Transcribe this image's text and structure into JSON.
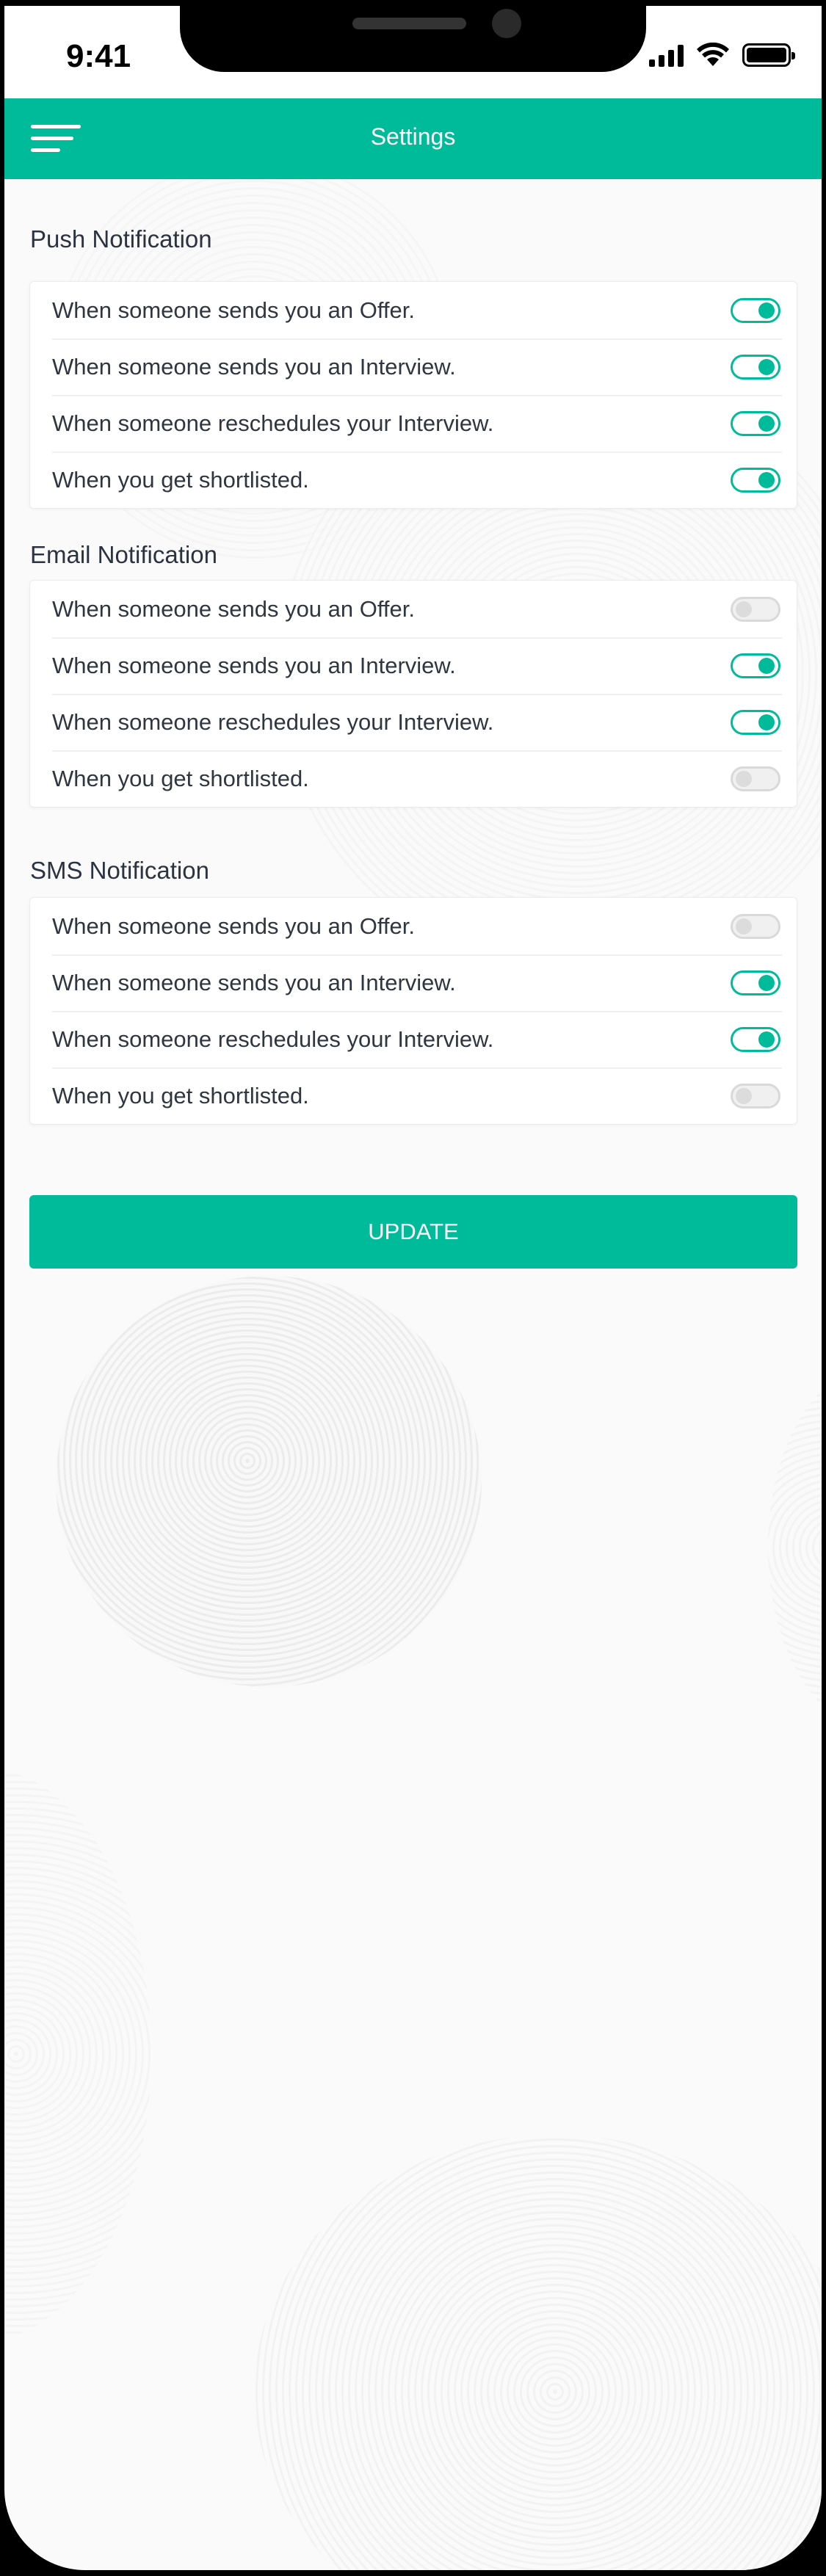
{
  "status_bar": {
    "time": "9:41"
  },
  "header": {
    "title": "Settings"
  },
  "sections": [
    {
      "title": "Push Notification",
      "items": [
        {
          "label": "When someone sends you an Offer.",
          "enabled": true
        },
        {
          "label": "When someone sends you an Interview.",
          "enabled": true
        },
        {
          "label": "When someone reschedules your Interview.",
          "enabled": true
        },
        {
          "label": "When you get shortlisted.",
          "enabled": true
        }
      ]
    },
    {
      "title": "Email Notification",
      "items": [
        {
          "label": "When someone sends you an Offer.",
          "enabled": false
        },
        {
          "label": "When someone sends you an Interview.",
          "enabled": true
        },
        {
          "label": "When someone reschedules your Interview.",
          "enabled": true
        },
        {
          "label": "When you get shortlisted.",
          "enabled": false
        }
      ]
    },
    {
      "title": "SMS Notification",
      "items": [
        {
          "label": "When someone sends you an Offer.",
          "enabled": false
        },
        {
          "label": "When someone sends you an Interview.",
          "enabled": true
        },
        {
          "label": "When someone reschedules your Interview.",
          "enabled": true
        },
        {
          "label": "When you get shortlisted.",
          "enabled": false
        }
      ]
    }
  ],
  "update_button": {
    "label": "UPDATE"
  },
  "colors": {
    "accent": "#00bb99",
    "background": "#fafafa",
    "text": "#30363f"
  },
  "icons": [
    "menu-icon",
    "signal-icon",
    "wifi-icon",
    "battery-icon"
  ]
}
